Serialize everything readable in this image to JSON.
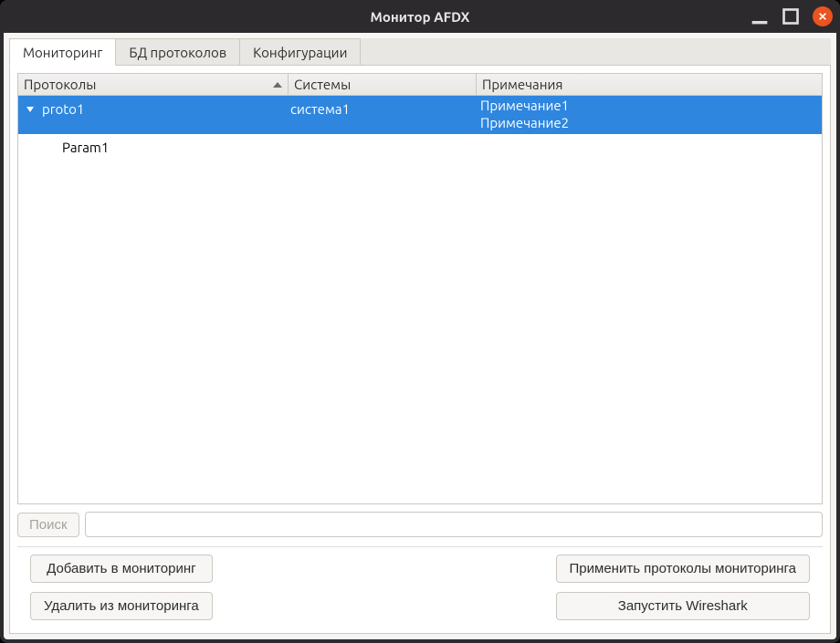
{
  "window": {
    "title": "Монитор AFDX"
  },
  "tabs": [
    {
      "label": "Мониторинг",
      "active": true
    },
    {
      "label": "БД протоколов",
      "active": false
    },
    {
      "label": "Конфигурации",
      "active": false
    }
  ],
  "tree": {
    "headers": {
      "col1": "Протоколы",
      "col2": "Системы",
      "col3": "Примечания"
    },
    "rows": [
      {
        "selected": true,
        "expanded": true,
        "protocol": "proto1",
        "system": "система1",
        "notes": [
          "Примечание1",
          "Примечание2"
        ]
      }
    ],
    "children": [
      {
        "protocol": "Param1",
        "system": "",
        "notes": []
      }
    ]
  },
  "search": {
    "button": "Поиск",
    "value": ""
  },
  "buttons": {
    "add": "Добавить в мониторинг",
    "remove": "Удалить из мониторинга",
    "apply": "Применить протоколы мониторинга",
    "wireshark": "Запустить Wireshark"
  }
}
